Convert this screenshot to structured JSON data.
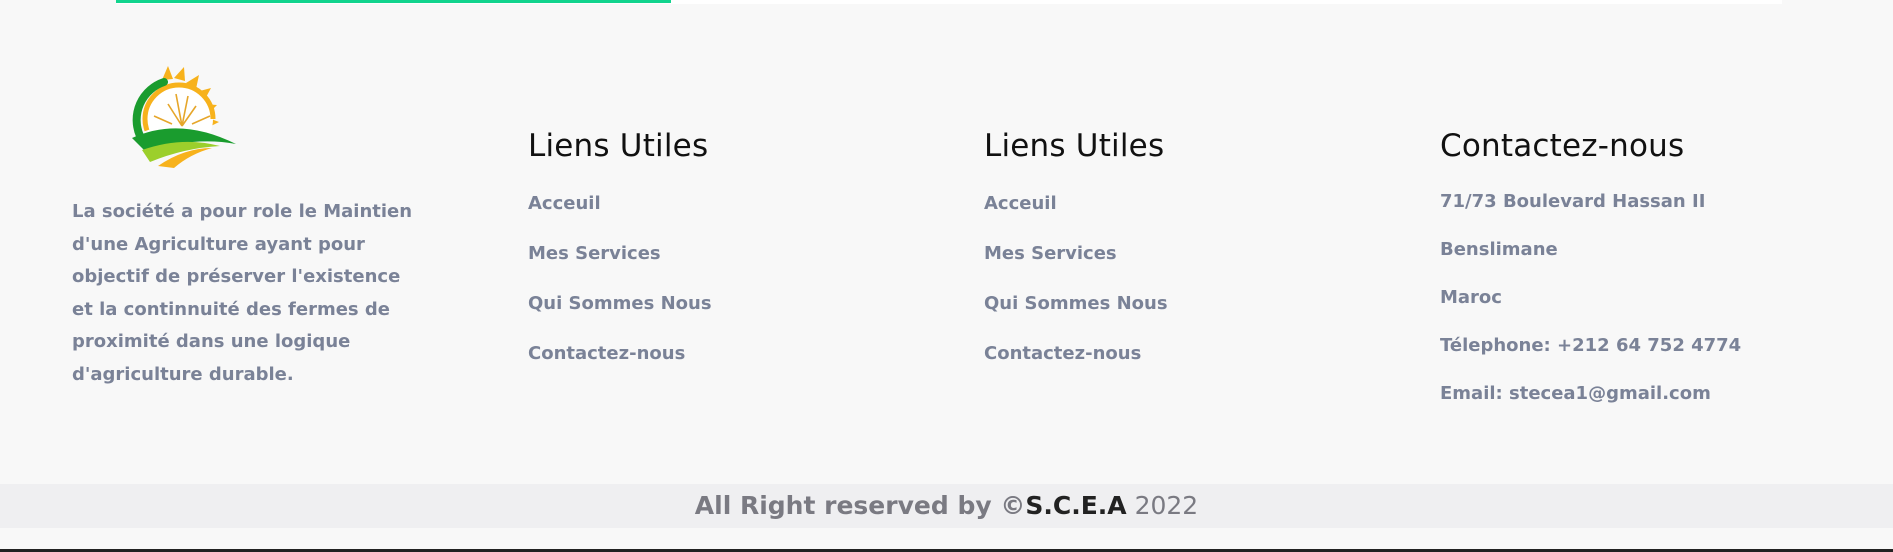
{
  "progress": {
    "fraction": 0.333
  },
  "about": {
    "text": "La société a pour role le Maintien d'une Agriculture ayant pour objectif de préserver l'existence et la continnuité des fermes de proximité dans une logique d'agriculture durable."
  },
  "columns": [
    {
      "title": "Liens Utiles",
      "links": [
        "Acceuil",
        "Mes Services",
        "Qui Sommes Nous",
        "Contactez-nous"
      ]
    },
    {
      "title": "Liens Utiles",
      "links": [
        "Acceuil",
        "Mes Services",
        "Qui Sommes Nous",
        "Contactez-nous"
      ]
    }
  ],
  "contact": {
    "title": "Contactez-nous",
    "lines": [
      "71/73 Boulevard Hassan II",
      "Benslimane",
      "Maroc",
      "Télephone: +212 64 752 4774",
      "Email: stecea1@gmail.com"
    ]
  },
  "footer": {
    "prefix": "All Right reserved by ©",
    "brand": "S.C.E.A",
    "year": " 2022"
  },
  "colors": {
    "accent": "#12d48e",
    "text_muted": "#7a8297"
  }
}
